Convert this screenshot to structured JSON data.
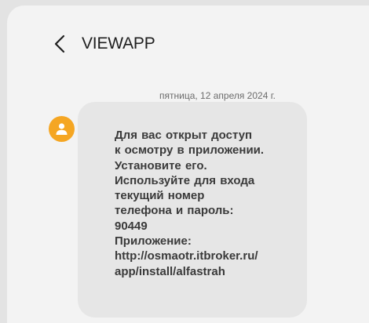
{
  "header": {
    "back_icon": "chevron-left-icon",
    "title": "VIEWAPP"
  },
  "thread": {
    "date_label": "пятница, 12 апреля 2024 г.",
    "avatar_icon": "person-icon",
    "avatar_color": "#f5a623",
    "message": {
      "text": "Для вас открыт доступ\nк осмотру в приложении.\nУстановите его.\nИспользуйте для входа\nтекущий номер\nтелефона и пароль:\n90449\nПриложение:\nhttp://osmaotr.itbroker.ru/\napp/install/alfastrah"
    }
  }
}
